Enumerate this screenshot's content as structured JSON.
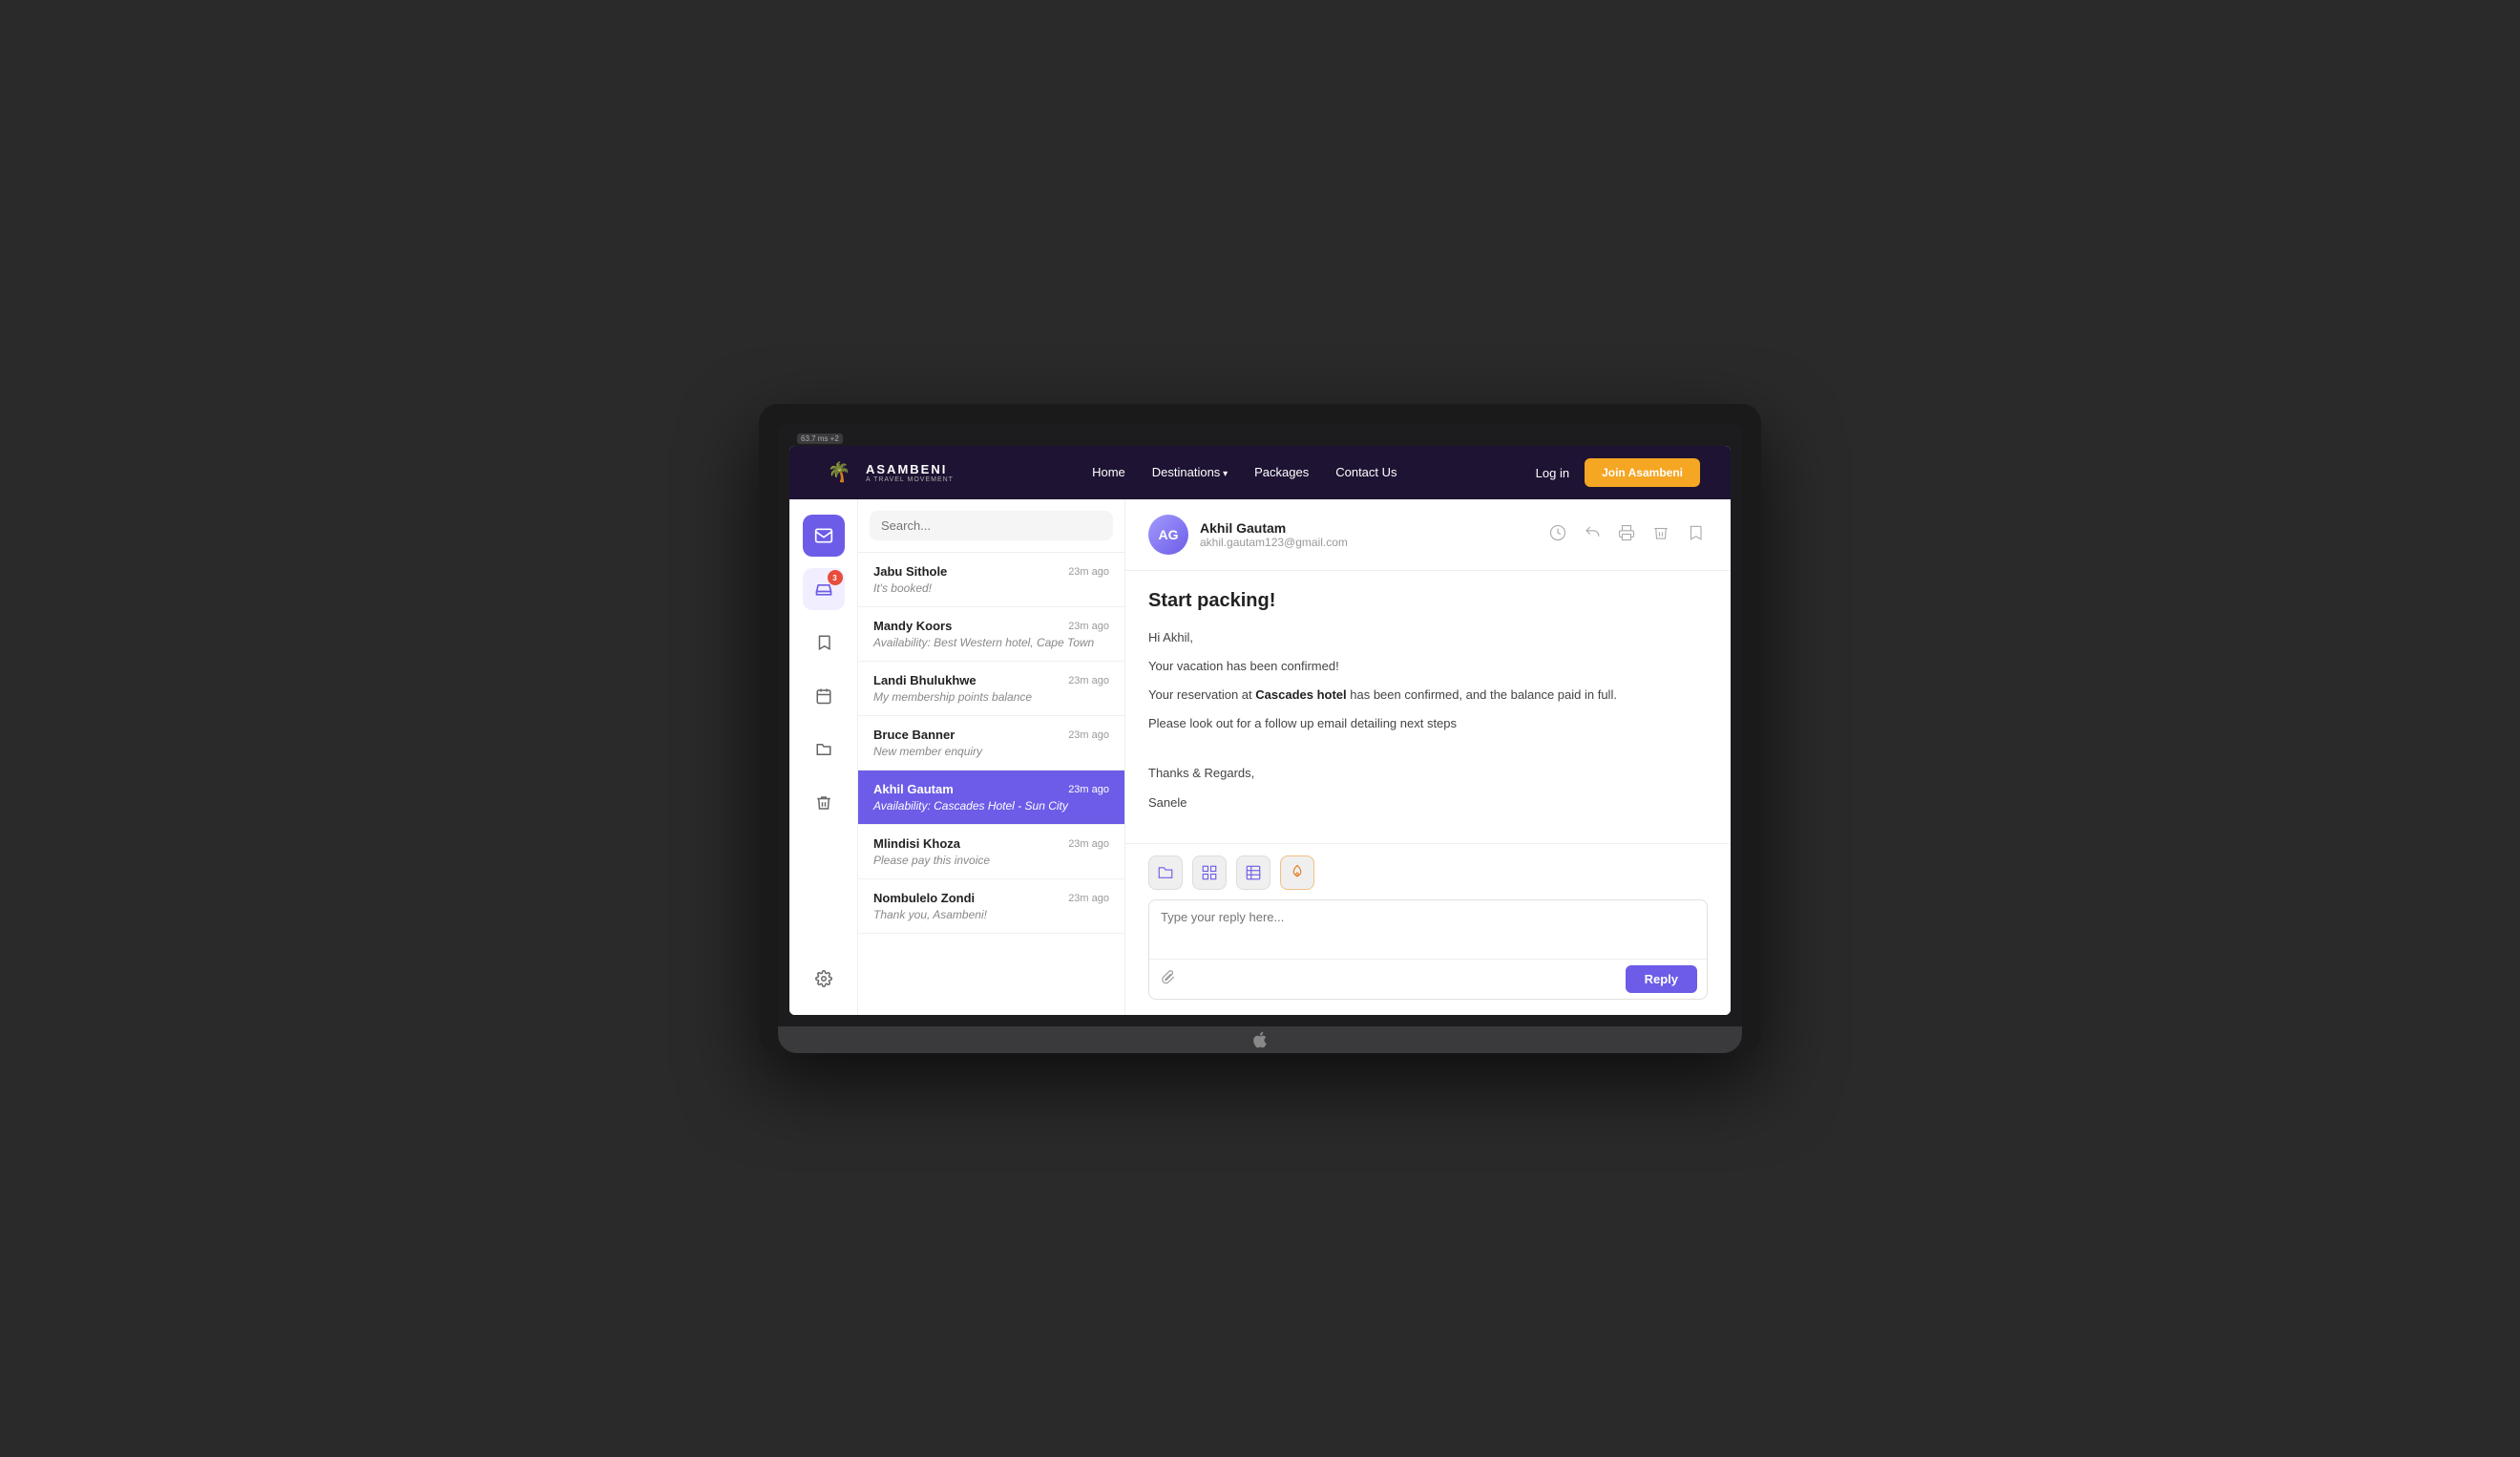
{
  "fps_badge": "63.7 ms +2",
  "navbar": {
    "logo_text": "ASAMBENI",
    "logo_sub": "A TRAVEL MOVEMENT",
    "links": [
      {
        "label": "Home",
        "has_arrow": false
      },
      {
        "label": "Destinations",
        "has_arrow": true
      },
      {
        "label": "Packages",
        "has_arrow": false
      },
      {
        "label": "Contact Us",
        "has_arrow": false
      }
    ],
    "login_label": "Log in",
    "join_label": "Join Asambeni"
  },
  "sidebar": {
    "icons": [
      {
        "name": "mail-icon",
        "symbol": "✉",
        "active": true,
        "badge": null
      },
      {
        "name": "inbox-icon",
        "symbol": "⬇",
        "secondary_active": true,
        "badge": "3"
      },
      {
        "name": "bookmark-icon",
        "symbol": "🔖",
        "badge": null
      },
      {
        "name": "calendar-icon",
        "symbol": "📅",
        "badge": null
      },
      {
        "name": "folder-icon",
        "symbol": "📁",
        "badge": null
      },
      {
        "name": "trash-icon",
        "symbol": "🗑",
        "badge": null
      }
    ],
    "settings_icon": {
      "name": "settings-icon",
      "symbol": "⚙"
    }
  },
  "search": {
    "placeholder": "Search..."
  },
  "messages": [
    {
      "name": "Jabu Sithole",
      "preview": "It's booked!",
      "time": "23m ago",
      "active": false
    },
    {
      "name": "Mandy Koors",
      "preview": "Availability: Best Western hotel, Cape Town",
      "time": "23m ago",
      "active": false
    },
    {
      "name": "Landi Bhulukhwe",
      "preview": "My membership points balance",
      "time": "23m ago",
      "active": false
    },
    {
      "name": "Bruce Banner",
      "preview": "New member enquiry",
      "time": "23m ago",
      "active": false
    },
    {
      "name": "Akhil Gautam",
      "preview": "Availability: Cascades Hotel - Sun City",
      "time": "23m ago",
      "active": true
    },
    {
      "name": "Mlindisi Khoza",
      "preview": "Please pay this invoice",
      "time": "23m ago",
      "active": false
    },
    {
      "name": "Nombulelo Zondi",
      "preview": "Thank you, Asambeni!",
      "time": "23m ago",
      "active": false
    }
  ],
  "email": {
    "sender_name": "Akhil Gautam",
    "sender_email": "akhil.gautam123@gmail.com",
    "sender_initials": "AG",
    "subject": "Start packing!",
    "body_lines": [
      "Hi Akhil,",
      "Your vacation has been confirmed!",
      "Your reservation at Cascades hotel has been confirmed, and the balance paid in full.",
      "Please look out for a follow up email detailing next steps",
      "",
      "Thanks & Regards,",
      "Sanele"
    ],
    "bold_phrase": "Cascades hotel",
    "actions": [
      "⊙",
      "↩",
      "🖨",
      "🗑",
      "🔖"
    ],
    "reply_placeholder": "Type your reply here...",
    "reply_label": "Reply"
  },
  "attachment_icons": [
    {
      "symbol": "📁",
      "type": "folder"
    },
    {
      "symbol": "⊞",
      "type": "grid"
    },
    {
      "symbol": "▦",
      "type": "table"
    },
    {
      "symbol": "🔥",
      "type": "fire"
    }
  ]
}
